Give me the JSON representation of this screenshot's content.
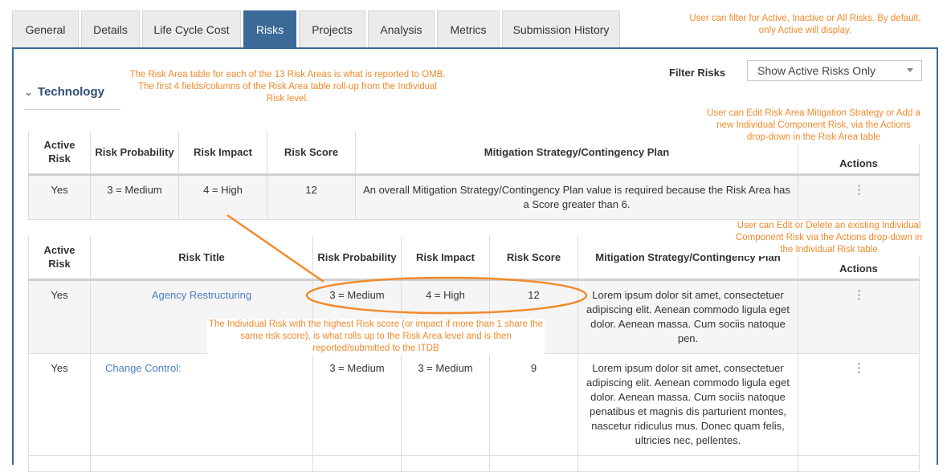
{
  "tabs": [
    {
      "label": "General"
    },
    {
      "label": "Details"
    },
    {
      "label": "Life Cycle Cost"
    },
    {
      "label": "Risks",
      "active": true
    },
    {
      "label": "Projects"
    },
    {
      "label": "Analysis"
    },
    {
      "label": "Metrics"
    },
    {
      "label": "Submission History"
    }
  ],
  "section": {
    "chevron": "⌄",
    "title": "Technology"
  },
  "filter": {
    "label": "Filter Risks",
    "value": "Show Active Risks Only"
  },
  "area_table": {
    "headers": [
      "Active Risk",
      "Risk Probability",
      "Risk Impact",
      "Risk Score",
      "Mitigation Strategy/Contingency Plan",
      "Actions"
    ],
    "row": {
      "active": "Yes",
      "probability": "3 = Medium",
      "impact": "4 = High",
      "score": "12",
      "mitigation": "An overall Mitigation Strategy/Contingency Plan value is required because the Risk Area has a Score greater than 6."
    }
  },
  "individual_table": {
    "headers": [
      "Active Risk",
      "Risk Title",
      "Risk Probability",
      "Risk Impact",
      "Risk Score",
      "Mitigation Strategy/Contingency Plan",
      "Actions"
    ],
    "rows": [
      {
        "active": "Yes",
        "title": "Agency Restructuring",
        "probability": "3 = Medium",
        "impact": "4 = High",
        "score": "12",
        "mitigation": "Lorem ipsum dolor sit amet, consectetuer adipiscing elit. Aenean commodo ligula eget dolor. Aenean massa. Cum sociis natoque pen."
      },
      {
        "active": "Yes",
        "title": "Change Control:",
        "probability": "3 = Medium",
        "impact": "3 = Medium",
        "score": "9",
        "mitigation": "Lorem ipsum dolor sit amet, consectetuer adipiscing elit. Aenean commodo ligula eget dolor. Aenean massa. Cum sociis natoque penatibus et magnis dis parturient montes, nascetur ridiculus mus. Donec quam felis, ultricies nec, pellentes."
      }
    ]
  },
  "notes": {
    "filter_note": "User can filter for Active, Inactive or All Risks.  By default, only Active will display.",
    "area_note": "The Risk Area table for each of the 13 Risk Areas is what is reported to OMB.  The first 4 fields/columns of the Risk Area table roll-up from the Individual Risk level.",
    "edit_area_note": "User can Edit Risk Area Mitigation Strategy or Add a new Individual Component Risk, via the Actions drop-down in the Risk Area table",
    "edit_individual_note": "User can Edit or Delete an existing Individual Component Risk via the Actions drop-down in the Individual Risk table",
    "highest_note": "The Individual Risk with the highest Risk score (or impact if more than 1 share the same risk score), is what rolls up to the Risk Area level and is then reported/submitted to the ITDB"
  },
  "colors": {
    "accent": "#3b6a99",
    "annotation": "#f28a2c",
    "link": "#4a7fc4"
  }
}
